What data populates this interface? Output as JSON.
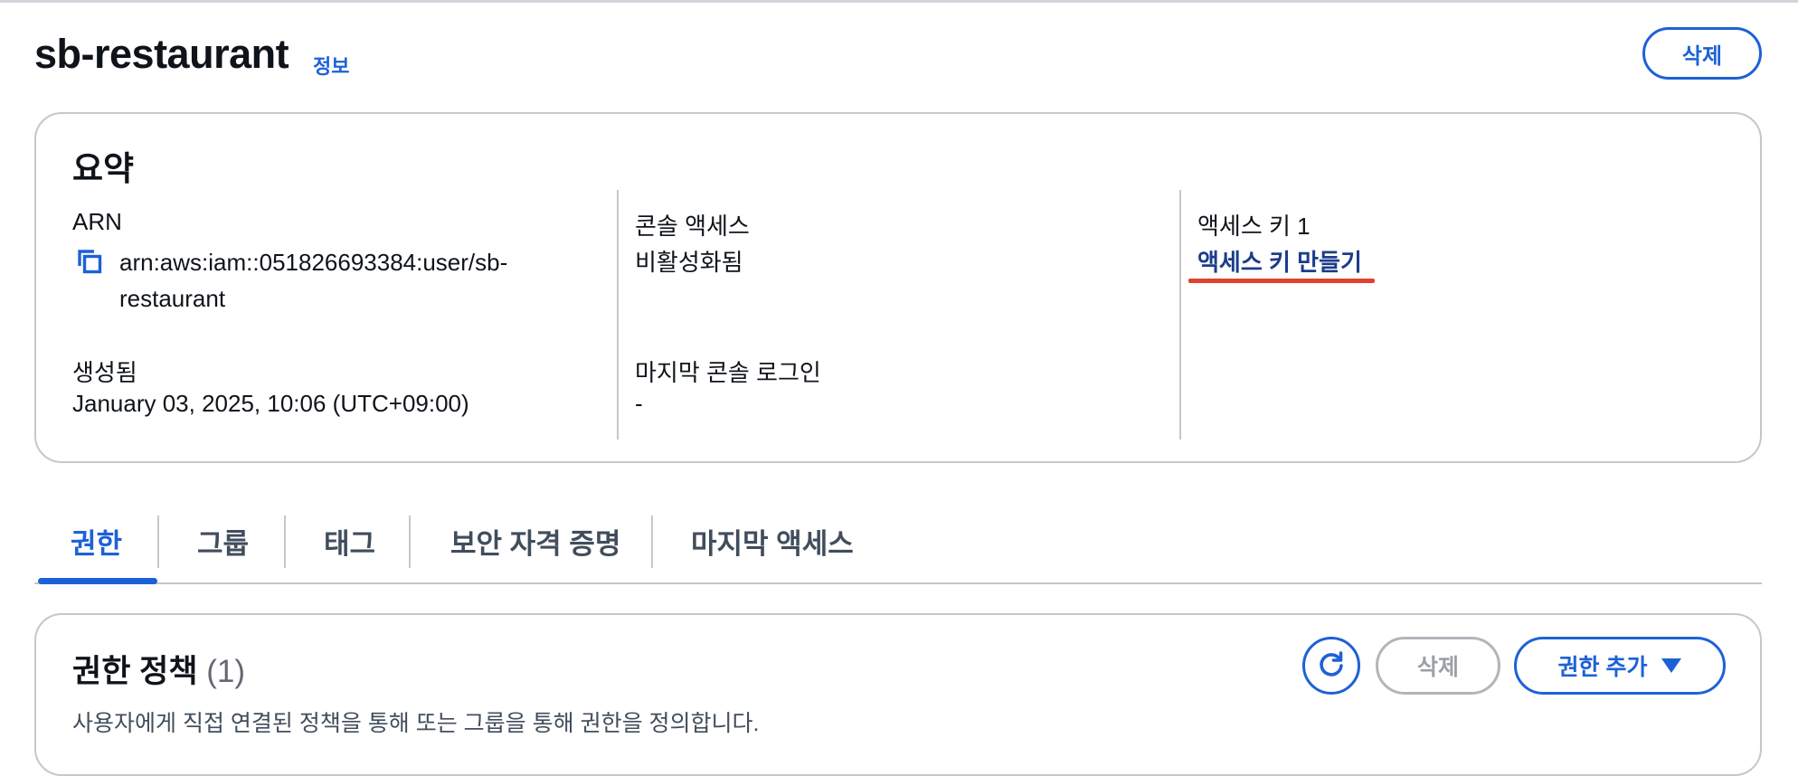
{
  "header": {
    "title": "sb-restaurant",
    "info_link": "정보",
    "delete_label": "삭제"
  },
  "summary": {
    "heading": "요약",
    "arn": {
      "label": "ARN",
      "value_line1": "arn:aws:iam::051826693384:user/sb-",
      "value_line2": "restaurant"
    },
    "created": {
      "label": "생성됨",
      "value": "January 03, 2025, 10:06 (UTC+09:00)"
    },
    "console_access": {
      "label": "콘솔 액세스",
      "value": "비활성화됨"
    },
    "last_console_login": {
      "label": "마지막 콘솔 로그인",
      "value": "-"
    },
    "access_key": {
      "label": "액세스 키 1",
      "link": "액세스 키 만들기"
    }
  },
  "tabs": [
    {
      "label": "권한",
      "active": true
    },
    {
      "label": "그룹",
      "active": false
    },
    {
      "label": "태그",
      "active": false
    },
    {
      "label": "보안 자격 증명",
      "active": false
    },
    {
      "label": "마지막 액세스",
      "active": false
    }
  ],
  "policies": {
    "title": "권한 정책",
    "count": "(1)",
    "description": "사용자에게 직접 연결된 정책을 통해 또는 그룹을 통해 권한을 정의합니다.",
    "delete_label": "삭제",
    "add_label": "권한 추가"
  },
  "colors": {
    "accent": "#1d61d6",
    "link_dark": "#1d3d8a",
    "highlight_underline": "#e0412e",
    "border": "#c6c6cd"
  },
  "icons": {
    "copy": "copy-icon",
    "refresh": "refresh-icon",
    "caret": "caret-down-icon"
  }
}
